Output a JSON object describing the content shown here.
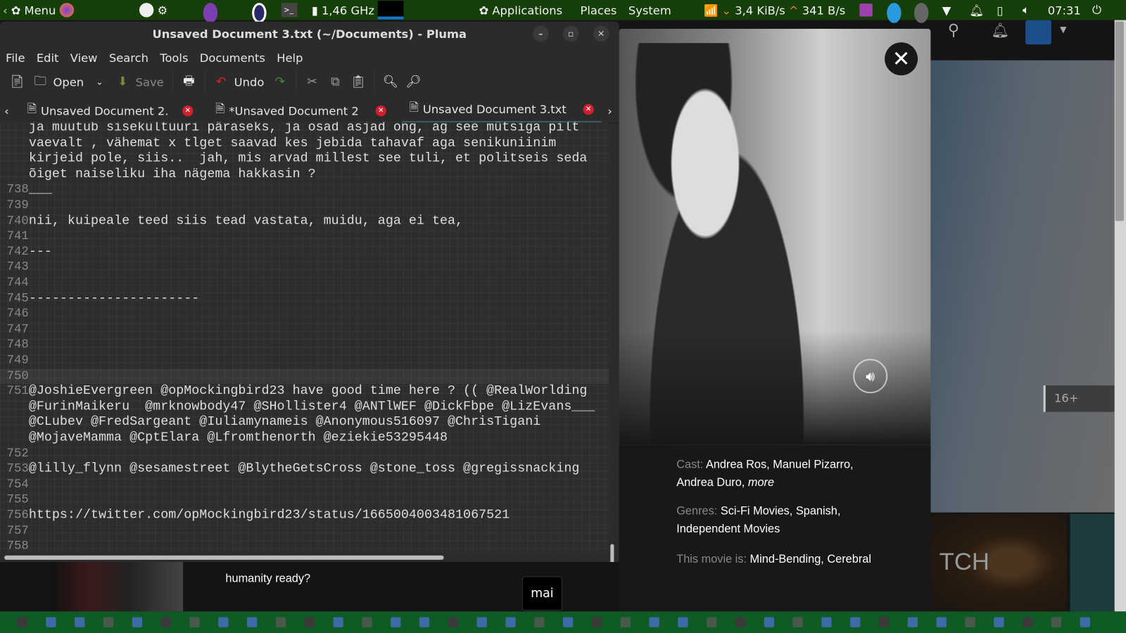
{
  "top_panel": {
    "menu_label": "Menu",
    "cpu_freq": "1,46 GHz",
    "applications": "Applications",
    "places": "Places",
    "system": "System",
    "net_down": "3,4 KiB/s",
    "net_up": "341 B/s",
    "clock": "07:31"
  },
  "window": {
    "title": "Unsaved Document 3.txt (~/Documents) - Pluma"
  },
  "menu": [
    "File",
    "Edit",
    "View",
    "Search",
    "Tools",
    "Documents",
    "Help"
  ],
  "toolbar": {
    "open": "Open",
    "save": "Save",
    "undo": "Undo"
  },
  "tabs": [
    {
      "label": "Unsaved Document 2."
    },
    {
      "label": "*Unsaved Document 2"
    },
    {
      "label": "Unsaved Document 3.txt",
      "active": true
    }
  ],
  "editor": {
    "current_line": "750",
    "lines": [
      {
        "n": "",
        "t": "ja muutub sisekultuuri päraseks, ja osad asjad ong, ag see mütsiga pilt"
      },
      {
        "n": "",
        "t": "vaevalt , vähemat x tlget saavad kes jebida tahavaf aga senikuniinim"
      },
      {
        "n": "",
        "t": "kirjeid pole, siis..  jah, mis arvad millest see tuli, et politseis seda"
      },
      {
        "n": "",
        "t": "õiget naiseliku iha nägema hakkasin ?"
      },
      {
        "n": "738",
        "t": "___"
      },
      {
        "n": "739",
        "t": ""
      },
      {
        "n": "740",
        "t": "nii, kuipeale teed siis tead vastata, muidu, aga ei tea,"
      },
      {
        "n": "741",
        "t": ""
      },
      {
        "n": "742",
        "t": "---"
      },
      {
        "n": "743",
        "t": ""
      },
      {
        "n": "744",
        "t": ""
      },
      {
        "n": "745",
        "t": "----------------------"
      },
      {
        "n": "746",
        "t": ""
      },
      {
        "n": "747",
        "t": ""
      },
      {
        "n": "748",
        "t": ""
      },
      {
        "n": "749",
        "t": ""
      },
      {
        "n": "750",
        "t": ""
      },
      {
        "n": "751",
        "t": "@JoshieEvergreen @opMockingbird23 have good time here ? (( @RealWorlding"
      },
      {
        "n": "",
        "t": "@FurinMaikeru  @mrknowbody47 @SHollister4 @ANTlWEF @DickFbpe @LizEvans___"
      },
      {
        "n": "",
        "t": "@CLubev @FredSargeant @Iuliamynameis @Anonymous516097 @ChrisTigani"
      },
      {
        "n": "",
        "t": "@MojaveMamma @CptElara @Lfromthenorth @eziekie53295448"
      },
      {
        "n": "752",
        "t": ""
      },
      {
        "n": "753",
        "t": "@lilly_flynn @sesamestreet @BlytheGetsCross @stone_toss @gregissnacking"
      },
      {
        "n": "754",
        "t": ""
      },
      {
        "n": "755",
        "t": ""
      },
      {
        "n": "756",
        "t": "https://twitter.com/opMockingbird23/status/1665004003481067521"
      },
      {
        "n": "757",
        "t": ""
      },
      {
        "n": "758",
        "t": ""
      }
    ]
  },
  "modal": {
    "cast_label": "Cast:",
    "cast": "Andrea Ros, Manuel Pizarro, Andrea Duro,",
    "cast_more": "more",
    "genres_label": "Genres:",
    "genres": "Sci-Fi Movies, Spanish, Independent Movies",
    "movie_is_label": "This movie is:",
    "movie_is": "Mind-Bending, Cerebral"
  },
  "background": {
    "synopsis_tail": "humanity ready?",
    "profile_tooltip": "mai",
    "maturity": "16+",
    "thumb_text": "TCH"
  }
}
